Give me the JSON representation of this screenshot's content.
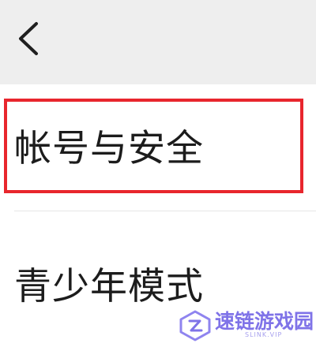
{
  "nav": {
    "back_icon": "chevron-left-icon"
  },
  "menu": {
    "items": [
      {
        "label": "帐号与安全",
        "highlighted": true,
        "highlight_color": "#e8262d"
      },
      {
        "label": "青少年模式",
        "highlighted": false
      }
    ]
  },
  "watermark": {
    "title": "速链游戏园",
    "subtitle": "SLINK.VIP",
    "color": "#7f73e8"
  }
}
